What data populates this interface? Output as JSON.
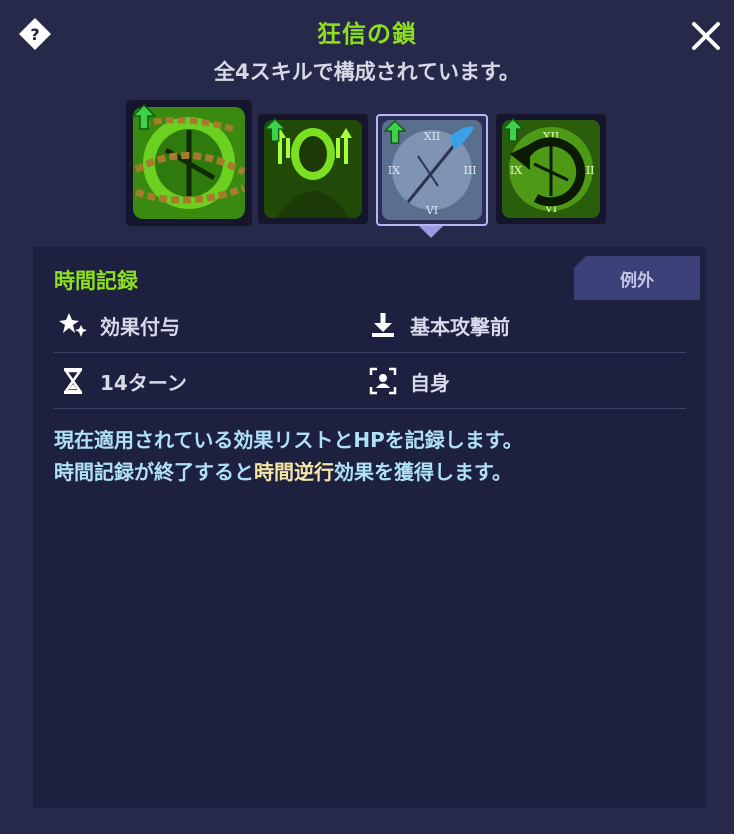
{
  "header": {
    "title": "狂信の鎖",
    "subtitle": "全4スキルで構成されています。"
  },
  "icons": {
    "help": "help-diamond-icon",
    "close": "close-x-icon"
  },
  "skills": [
    {
      "name": "chained-clock-skill",
      "upgrade": true
    },
    {
      "name": "green-aura-figure-skill",
      "upgrade": true
    },
    {
      "name": "clock-arrow-skill",
      "upgrade": true,
      "selected": true
    },
    {
      "name": "rewind-clock-skill",
      "upgrade": true
    }
  ],
  "detail": {
    "skill_name": "時間記録",
    "tag": "例外",
    "stats": {
      "effect_label": "効果付与",
      "timing_label": "基本攻撃前",
      "duration_label": "14ターン",
      "target_label": "自身"
    },
    "description": {
      "line1": "現在適用されている効果リストとHPを記録します。",
      "line2_pre": "時間記録が終了すると",
      "line2_highlight": "時間逆行",
      "line2_post": "効果を獲得します。"
    }
  },
  "colors": {
    "accent_green": "#8ee01c",
    "highlight_yellow": "#f5e6a8",
    "desc_blue": "#aee0f6",
    "panel_bg": "#262949"
  }
}
